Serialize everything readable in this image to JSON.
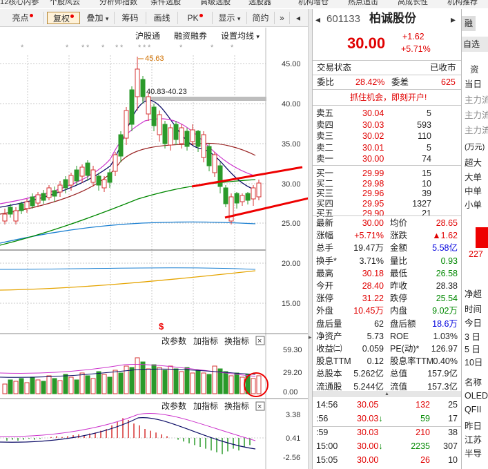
{
  "top_menu": [
    "12核心内参",
    "个股风云",
    "分析师指数",
    "条件选股",
    "高级选股",
    "选股器",
    "机构增仓",
    "热点追击",
    "高成长性",
    "机构推荐"
  ],
  "toolbar": {
    "buttons": [
      "亮点",
      "复权",
      "叠加",
      "筹码",
      "画线",
      "PK",
      "显示",
      "简约"
    ],
    "more": "»"
  },
  "chart": {
    "links": [
      "沪股通",
      "融资融券",
      "设置均线"
    ],
    "price_ticks": [
      "45.00",
      "40.00",
      "35.00",
      "30.00",
      "25.00",
      "20.00",
      "15.00"
    ],
    "high_label": "45.63",
    "range_label": "40.83-40.23",
    "vol_panel": {
      "btns": [
        "改参数",
        "加指标",
        "换指标"
      ],
      "ticks": [
        "59.30",
        "29.20",
        "0.00"
      ],
      "close": "×"
    },
    "macd_panel": {
      "btns": [
        "改参数",
        "加指标",
        "换指标"
      ],
      "ticks": [
        "3.38",
        "0.41",
        "-2.56"
      ],
      "close": "×"
    },
    "marker": "$"
  },
  "stock": {
    "code": "601133",
    "name": "柏诚股份",
    "price": "30.00",
    "change": "+1.62",
    "change_pct": "+5.71%",
    "status_label": "交易状态",
    "status_value": "已收市",
    "weibi_label": "委比",
    "weibi_value": "28.42%",
    "weicha_label": "委差",
    "weicha_value": "625",
    "promo": "抓住机会，即刻开户!",
    "sells": [
      {
        "label": "卖五",
        "price": "30.04",
        "vol": "5"
      },
      {
        "label": "卖四",
        "price": "30.03",
        "vol": "593"
      },
      {
        "label": "卖三",
        "price": "30.02",
        "vol": "110"
      },
      {
        "label": "卖二",
        "price": "30.01",
        "vol": "5"
      },
      {
        "label": "卖一",
        "price": "30.00",
        "vol": "74"
      }
    ],
    "buys": [
      {
        "label": "买一",
        "price": "29.99",
        "vol": "15"
      },
      {
        "label": "买二",
        "price": "29.98",
        "vol": "10"
      },
      {
        "label": "买三",
        "price": "29.96",
        "vol": "39"
      },
      {
        "label": "买四",
        "price": "29.95",
        "vol": "1327"
      },
      {
        "label": "买五",
        "price": "29.90",
        "vol": "21"
      }
    ],
    "stats": [
      [
        "最新",
        "30.00",
        "red",
        "均价",
        "28.65",
        "red"
      ],
      [
        "涨幅",
        "+5.71%",
        "red",
        "涨跌",
        "▲1.62",
        "red"
      ],
      [
        "总手",
        "19.47万",
        "dark",
        "金额",
        "5.58亿",
        "blue"
      ],
      [
        "换手*",
        "3.71%",
        "dark",
        "量比",
        "0.93",
        "green"
      ],
      [
        "最高",
        "30.18",
        "red",
        "最低",
        "26.58",
        "green"
      ],
      [
        "今开",
        "28.40",
        "red",
        "昨收",
        "28.38",
        "dark"
      ],
      [
        "涨停",
        "31.22",
        "red",
        "跌停",
        "25.54",
        "green"
      ],
      [
        "外盘",
        "10.45万",
        "red",
        "内盘",
        "9.02万",
        "green"
      ],
      [
        "盘后量",
        "62",
        "dark",
        "盘后额",
        "18.6万",
        "blue"
      ],
      [
        "净资产",
        "5.73",
        "dark",
        "ROE",
        "1.03%",
        "dark"
      ],
      [
        "收益㈡",
        "0.059",
        "dark",
        "PE(动)*",
        "126.97",
        "dark"
      ],
      [
        "股息TTM",
        "0.12",
        "dark",
        "股息率TTM",
        "0.40%",
        "dark"
      ],
      [
        "总股本",
        "5.262亿",
        "dark",
        "总值",
        "157.9亿",
        "dark"
      ],
      [
        "流通股",
        "5.244亿",
        "dark",
        "流值",
        "157.3亿",
        "dark"
      ]
    ],
    "ticks": [
      {
        "time": "14:56",
        "price": "30.05",
        "arrow": "",
        "vol": "132",
        "vcolor": "red",
        "n": "25"
      },
      {
        "time": ":56",
        "price": "30.03",
        "arrow": "↓",
        "vol": "59",
        "vcolor": "green",
        "n": "17"
      },
      {
        "time": ":59",
        "price": "30.03",
        "arrow": "",
        "vol": "210",
        "vcolor": "red",
        "n": "38"
      },
      {
        "time": "15:00",
        "price": "30.00",
        "arrow": "↓",
        "vol": "2235",
        "vcolor": "green",
        "n": "307"
      },
      {
        "time": "15:05",
        "price": "30.00",
        "arrow": "",
        "vol": "26",
        "vcolor": "red",
        "n": "10"
      }
    ]
  },
  "far_right": {
    "rong": "融",
    "zixuan": "自选",
    "zi": "资",
    "items1": [
      "当日",
      "主力流",
      "主力流",
      "主力流"
    ],
    "unit": "(万元)",
    "items2": [
      "超大",
      "大单",
      "中单",
      "小单"
    ],
    "bar_val": "227",
    "items3": [
      "净超",
      "时间",
      "今日",
      "3 日",
      "5 日",
      "10日"
    ],
    "items4": [
      "名称",
      "OLED",
      "QFII",
      "昨日",
      "江苏",
      "半导"
    ]
  }
}
